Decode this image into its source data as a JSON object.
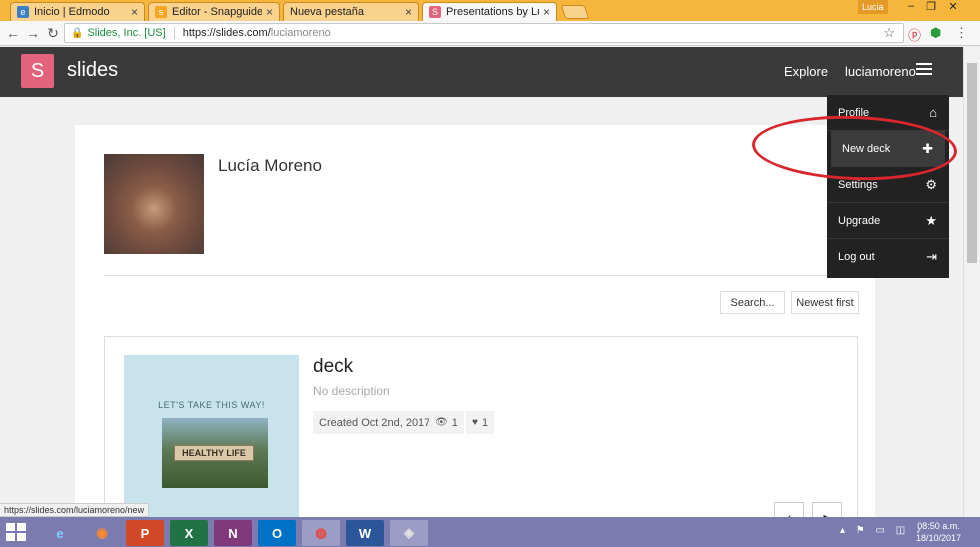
{
  "browser": {
    "tabs": [
      {
        "title": "Inicio | Edmodo",
        "favicon": "edmodo-icon",
        "favicon_color": "#3b7fc4"
      },
      {
        "title": "Editor - Snapguide",
        "favicon": "snapguide-icon",
        "favicon_color": "#f5a623"
      },
      {
        "title": "Nueva pestaña",
        "favicon": "",
        "favicon_color": ""
      },
      {
        "title": "Presentations by Lucía M",
        "favicon": "slides-icon",
        "favicon_color": "#e4637c"
      }
    ],
    "active_tab": 3,
    "profile_name": "Lucia",
    "close_glyph": "×",
    "security_label": "Slides, Inc. [US]",
    "url_base": "https://slides.com/",
    "url_path": "luciamoreno",
    "hover_url": "https://slides.com/luciamoreno/new"
  },
  "site": {
    "logo_letter": "S",
    "logo_text": "slides",
    "nav_explore": "Explore",
    "nav_user": "luciamoreno",
    "accent_color": "#e4637c"
  },
  "profile": {
    "name": "Lucía Moreno"
  },
  "controls": {
    "search_label": "Search...",
    "sort_label": "Newest first"
  },
  "deck": {
    "title": "deck",
    "description": "No description",
    "created": "Created Oct 2nd, 2017",
    "views": "1",
    "likes": "1",
    "thumb_caption": "LET'S TAKE THIS WAY!",
    "thumb_sign": "HEALTHY LIFE"
  },
  "menu": {
    "items": [
      {
        "label": "Profile",
        "icon": "home-icon"
      },
      {
        "label": "New deck",
        "icon": "plus-icon"
      },
      {
        "label": "Settings",
        "icon": "gear-icon"
      },
      {
        "label": "Upgrade",
        "icon": "star-icon"
      },
      {
        "label": "Log out",
        "icon": "logout-icon"
      }
    ],
    "highlighted": "New deck",
    "annotation_color": "#d8262c"
  },
  "taskbar": {
    "apps": [
      {
        "name": "internet-explorer",
        "glyph": "e"
      },
      {
        "name": "firefox",
        "glyph": "◉"
      },
      {
        "name": "powerpoint",
        "glyph": "P"
      },
      {
        "name": "excel",
        "glyph": "X"
      },
      {
        "name": "onenote",
        "glyph": "N"
      },
      {
        "name": "outlook",
        "glyph": "O"
      },
      {
        "name": "chrome",
        "glyph": "◍"
      },
      {
        "name": "word",
        "glyph": "W"
      },
      {
        "name": "unknown-app",
        "glyph": "◈"
      }
    ],
    "time": "08:50 a.m.",
    "date": "18/10/2017"
  }
}
